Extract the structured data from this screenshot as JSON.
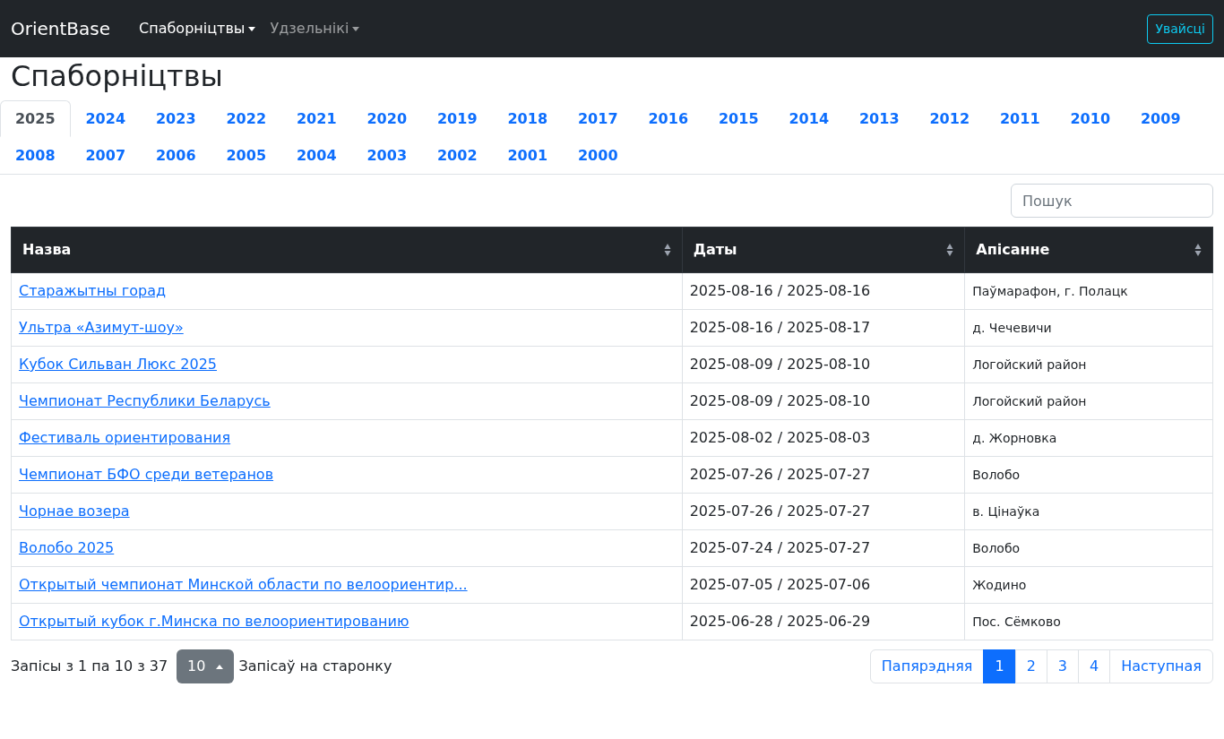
{
  "navbar": {
    "brand": "OrientBase",
    "items": [
      {
        "label": "Спаборніцтвы",
        "selected": true
      },
      {
        "label": "Удзельнікі",
        "selected": false
      }
    ],
    "login": "Увайсці"
  },
  "title": "Спаборніцтвы",
  "tabs": [
    {
      "label": "2025",
      "selected": true
    },
    {
      "label": "2024",
      "selected": false
    },
    {
      "label": "2023",
      "selected": false
    },
    {
      "label": "2022",
      "selected": false
    },
    {
      "label": "2021",
      "selected": false
    },
    {
      "label": "2020",
      "selected": false
    },
    {
      "label": "2019",
      "selected": false
    },
    {
      "label": "2018",
      "selected": false
    },
    {
      "label": "2017",
      "selected": false
    },
    {
      "label": "2016",
      "selected": false
    },
    {
      "label": "2015",
      "selected": false
    },
    {
      "label": "2014",
      "selected": false
    },
    {
      "label": "2013",
      "selected": false
    },
    {
      "label": "2012",
      "selected": false
    },
    {
      "label": "2011",
      "selected": false
    },
    {
      "label": "2010",
      "selected": false
    },
    {
      "label": "2009",
      "selected": false
    },
    {
      "label": "2008",
      "selected": false
    },
    {
      "label": "2007",
      "selected": false
    },
    {
      "label": "2006",
      "selected": false
    },
    {
      "label": "2005",
      "selected": false
    },
    {
      "label": "2004",
      "selected": false
    },
    {
      "label": "2003",
      "selected": false
    },
    {
      "label": "2002",
      "selected": false
    },
    {
      "label": "2001",
      "selected": false
    },
    {
      "label": "2000",
      "selected": false
    }
  ],
  "search": {
    "placeholder": "Пошук"
  },
  "table": {
    "columns": [
      "Назва",
      "Даты",
      "Апісанне"
    ],
    "rows": [
      [
        "Старажытны горад",
        "2025-08-16 / 2025-08-16",
        "Паўмарафон, г. Полацк"
      ],
      [
        "Ультра «Азимут-шоу»",
        "2025-08-16 / 2025-08-17",
        "д. Чечевичи"
      ],
      [
        "Кубок Сильван Люкс 2025",
        "2025-08-09 / 2025-08-10",
        "Логойский район"
      ],
      [
        "Чемпионат Республики Беларусь",
        "2025-08-09 / 2025-08-10",
        "Логойский район"
      ],
      [
        "Фестиваль ориентирования",
        "2025-08-02 / 2025-08-03",
        "д. Жорновка"
      ],
      [
        "Чемпионат БФО среди ветеранов",
        "2025-07-26 / 2025-07-27",
        "Волобо"
      ],
      [
        "Чорнае возера",
        "2025-07-26 / 2025-07-27",
        "в. Цінаўка"
      ],
      [
        "Волобо 2025",
        "2025-07-24 / 2025-07-27",
        "Волобо"
      ],
      [
        "Открытый чемпионат Минской области по велоориентир...",
        "2025-07-05 / 2025-07-06",
        "Жодино"
      ],
      [
        "Открытый кубок г.Минска по велоориентированию",
        "2025-06-28 / 2025-06-29",
        "Пос. Сёмково"
      ]
    ]
  },
  "footer": {
    "info": "Запісы з 1 па 10 з 37",
    "page_size": "10",
    "page_size_label": "Запісаў на старонку"
  },
  "pagination": [
    {
      "label": "Папярэдняя",
      "selected": false
    },
    {
      "label": "1",
      "selected": true
    },
    {
      "label": "2",
      "selected": false
    },
    {
      "label": "3",
      "selected": false
    },
    {
      "label": "4",
      "selected": false
    },
    {
      "label": "Наступная",
      "selected": false
    }
  ]
}
